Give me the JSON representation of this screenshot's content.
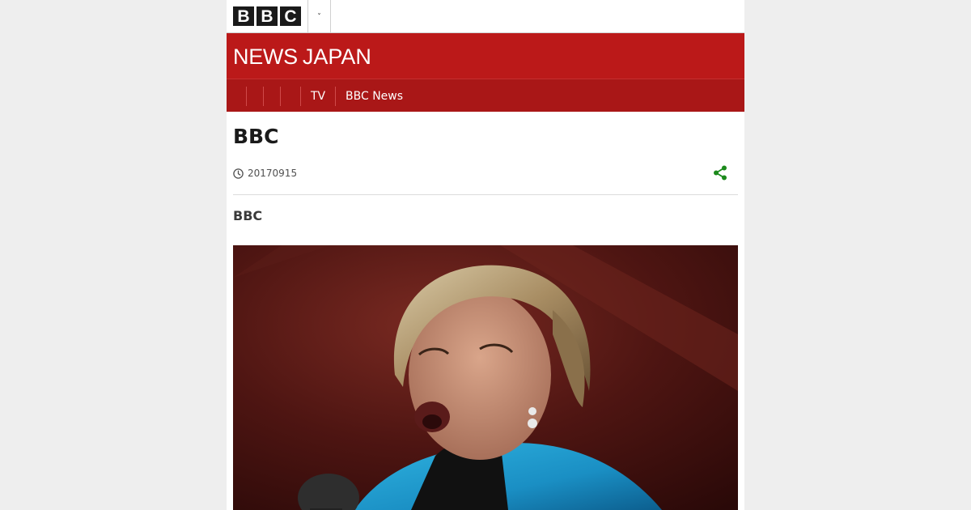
{
  "header": {
    "logo_letters": [
      "B",
      "B",
      "C"
    ],
    "menu_toggle_icon": "chevron-down-icon",
    "menu_toggle_glyph": "ˇ"
  },
  "masthead": {
    "brand_news": "NEWS",
    "brand_japan": "JAPAN"
  },
  "nav": {
    "items": [
      {
        "label": ""
      },
      {
        "label": ""
      },
      {
        "label": ""
      },
      {
        "label": "TV"
      },
      {
        "label": "BBC News"
      }
    ]
  },
  "article": {
    "headline": "BBC",
    "date_icon": "clock-icon",
    "date": "20170915",
    "share_icon": "share-icon",
    "share_color": "#1c8a1c",
    "intro": "BBC",
    "photo_icon": "lead-photo"
  },
  "colors": {
    "brand_red": "#bb1919",
    "nav_red": "#a91717",
    "page_background": "#eeeeee"
  }
}
